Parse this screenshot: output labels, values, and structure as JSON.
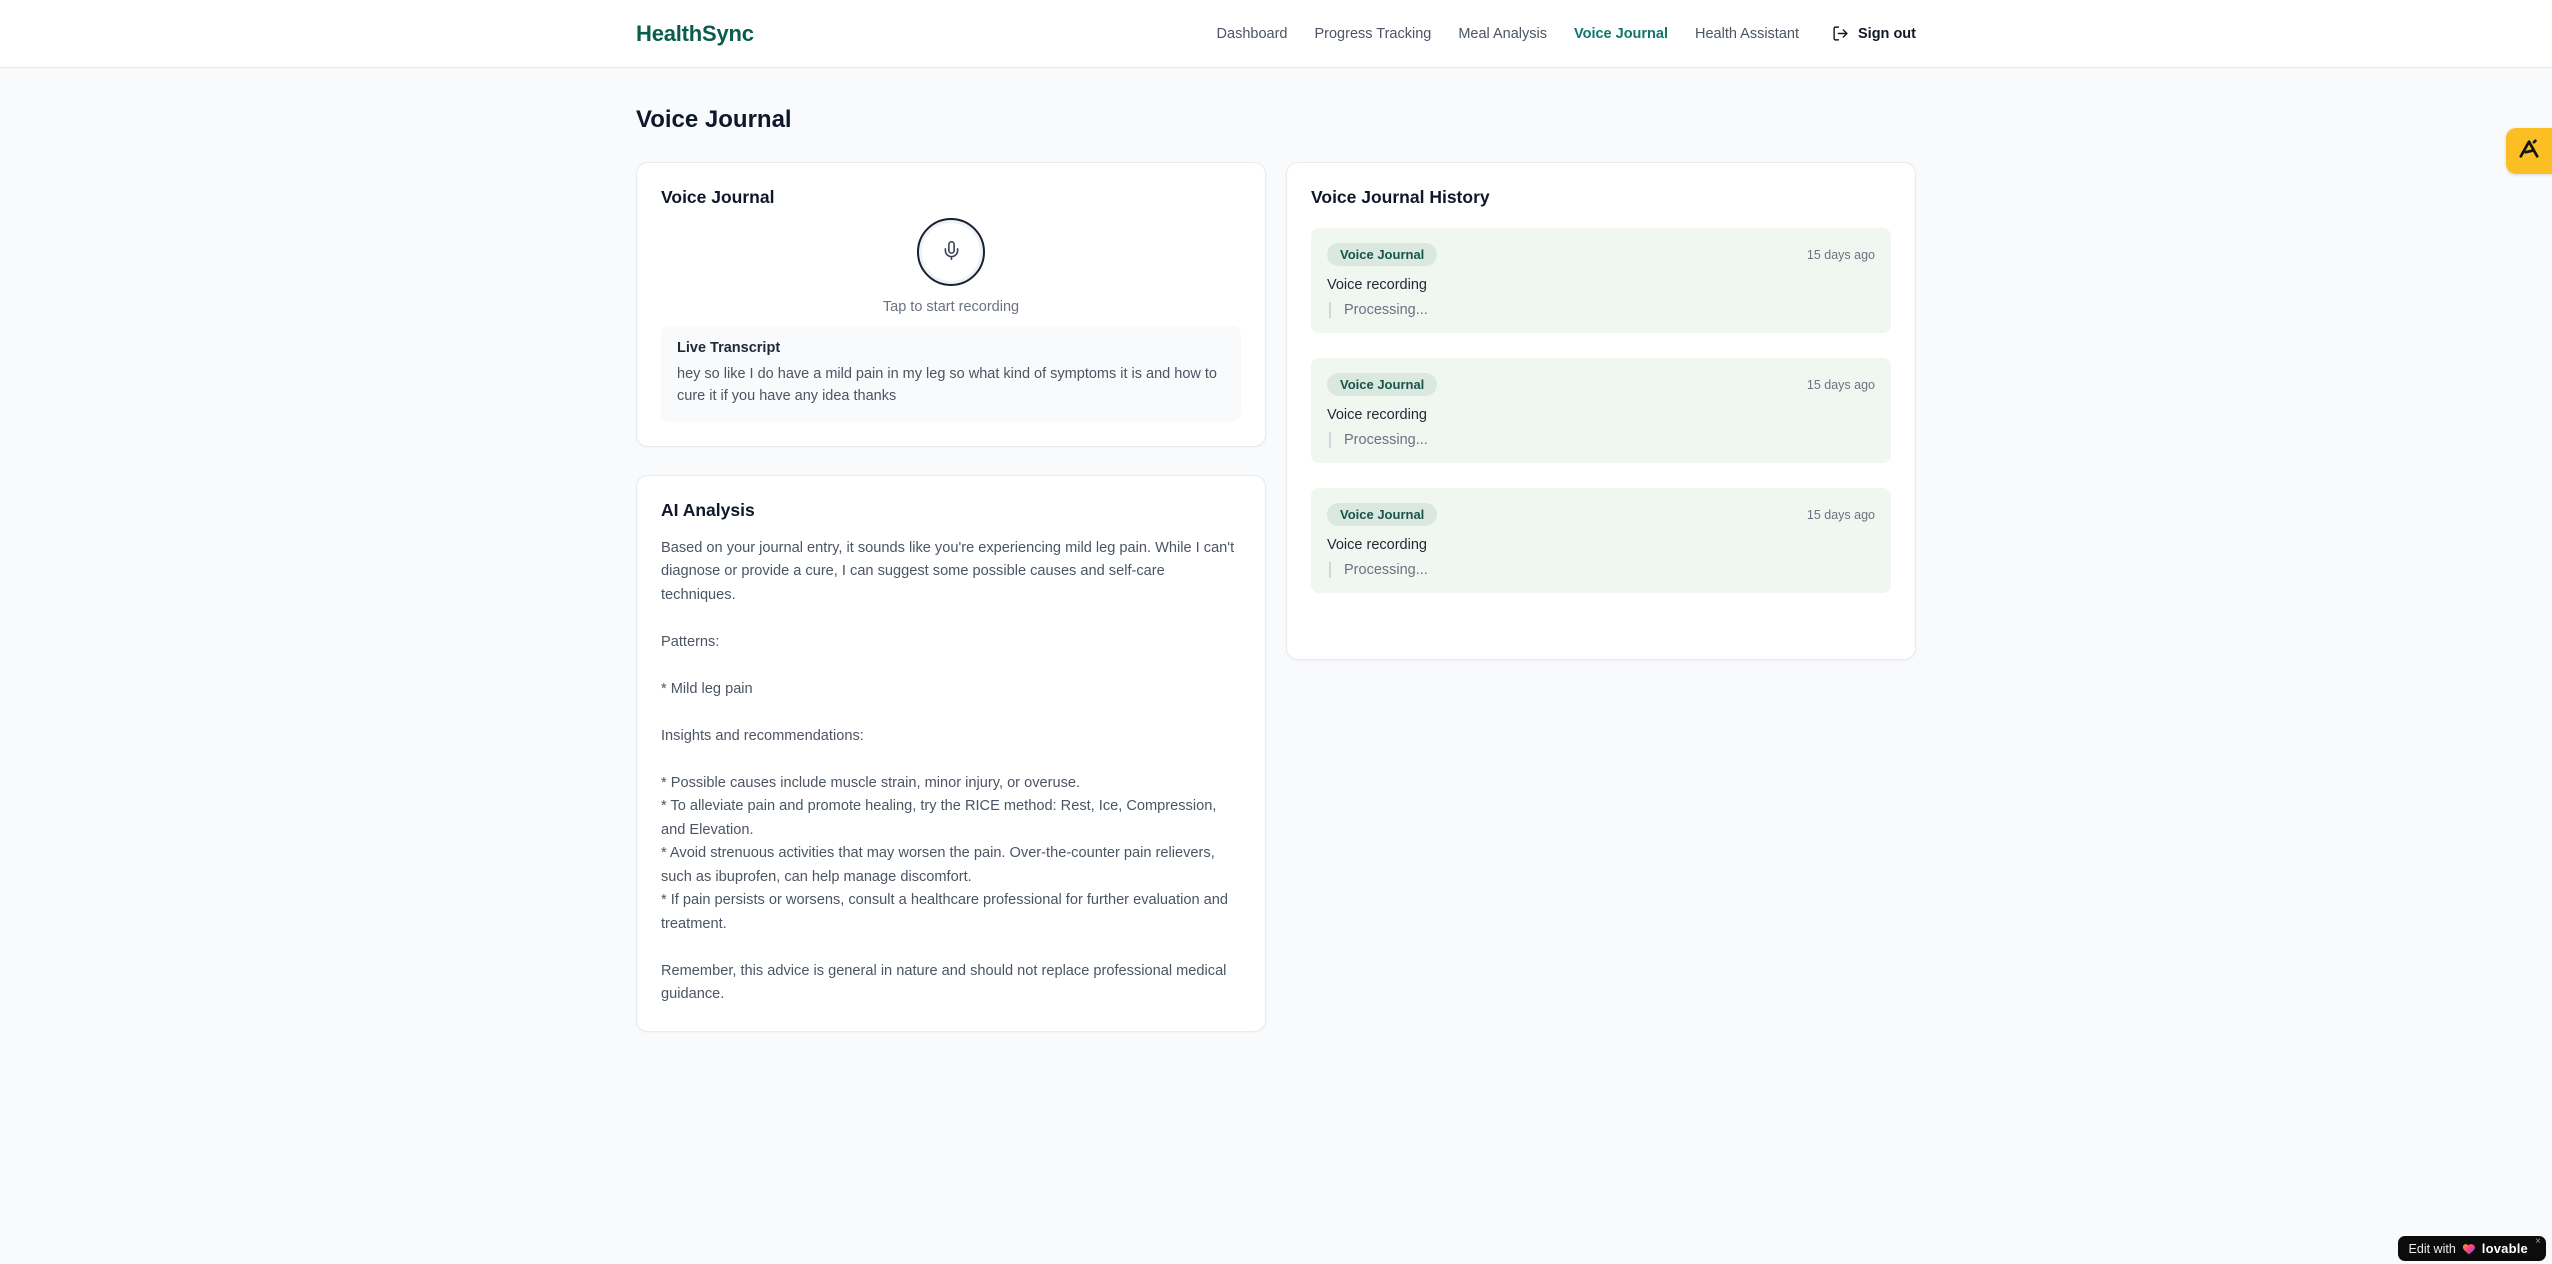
{
  "brand": {
    "name": "HealthSync"
  },
  "nav": {
    "items": [
      {
        "label": "Dashboard",
        "active": false
      },
      {
        "label": "Progress Tracking",
        "active": false
      },
      {
        "label": "Meal Analysis",
        "active": false
      },
      {
        "label": "Voice Journal",
        "active": true
      },
      {
        "label": "Health Assistant",
        "active": false
      }
    ],
    "sign_out_label": "Sign out"
  },
  "page": {
    "title": "Voice Journal"
  },
  "recorder_card": {
    "title": "Voice Journal",
    "mic_icon": "microphone-icon",
    "hint": "Tap to start recording",
    "transcript_title": "Live Transcript",
    "transcript_text": "hey so like I do have a mild pain in my leg so what kind of symptoms it is and how to cure it if you have any idea thanks"
  },
  "analysis_card": {
    "title": "AI Analysis",
    "body": "Based on your journal entry, it sounds like you're experiencing mild leg pain. While I can't diagnose or provide a cure, I can suggest some possible causes and self-care techniques.\n\nPatterns:\n\n* Mild leg pain\n\nInsights and recommendations:\n\n* Possible causes include muscle strain, minor injury, or overuse.\n* To alleviate pain and promote healing, try the RICE method: Rest, Ice, Compression, and Elevation.\n* Avoid strenuous activities that may worsen the pain. Over-the-counter pain relievers, such as ibuprofen, can help manage discomfort.\n* If pain persists or worsens, consult a healthcare professional for further evaluation and treatment.\n\nRemember, this advice is general in nature and should not replace professional medical guidance."
  },
  "history_card": {
    "title": "Voice Journal History",
    "entries": [
      {
        "badge": "Voice Journal",
        "time": "15 days ago",
        "label": "Voice recording",
        "status": "Processing..."
      },
      {
        "badge": "Voice Journal",
        "time": "15 days ago",
        "label": "Voice recording",
        "status": "Processing..."
      },
      {
        "badge": "Voice Journal",
        "time": "15 days ago",
        "label": "Voice recording",
        "status": "Processing..."
      }
    ]
  },
  "badges": {
    "lovable_prefix": "Edit with",
    "lovable_brand": "lovable",
    "lovable_close": "×"
  },
  "colors": {
    "brand_green": "#095d4c",
    "nav_active_teal": "#0f766e",
    "entry_bg_green": "#f0f7f1",
    "badge_pill_green": "#dbe8e0",
    "badge_text_green": "#17544a",
    "amber_badge": "#fbbf24",
    "page_bg": "#f8fafc"
  }
}
